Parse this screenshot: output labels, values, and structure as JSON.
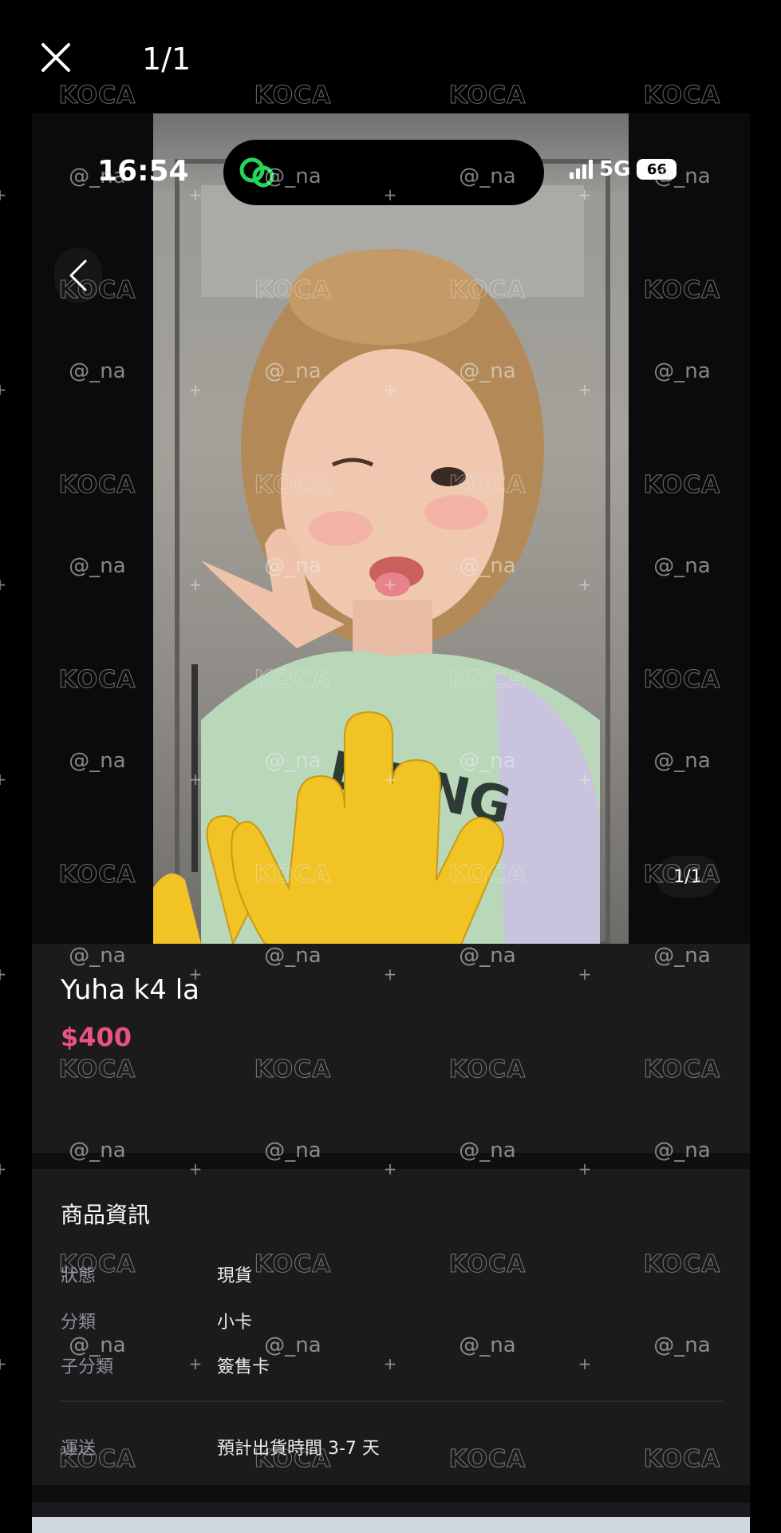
{
  "viewer": {
    "counter": "1/1"
  },
  "status_bar": {
    "time": "16:54",
    "network": "5G",
    "battery": "66"
  },
  "product": {
    "image_counter": "1/1",
    "title": "Yuha k4 la",
    "price": "$400",
    "price_color": "#e9537d"
  },
  "info": {
    "section_title": "商品資訊",
    "rows": [
      {
        "key": "狀態",
        "value": "現貨"
      },
      {
        "key": "分類",
        "value": "小卡"
      },
      {
        "key": "子分類",
        "value": "簽售卡"
      }
    ],
    "shipping": {
      "key": "運送",
      "value": "預計出貨時間 3-7 天"
    }
  },
  "watermark": {
    "logo_text": "KOCA",
    "handle": "@_na"
  },
  "icons": {
    "close": "close-icon",
    "back": "chevron-left-icon",
    "app": "app-logo-icon"
  }
}
